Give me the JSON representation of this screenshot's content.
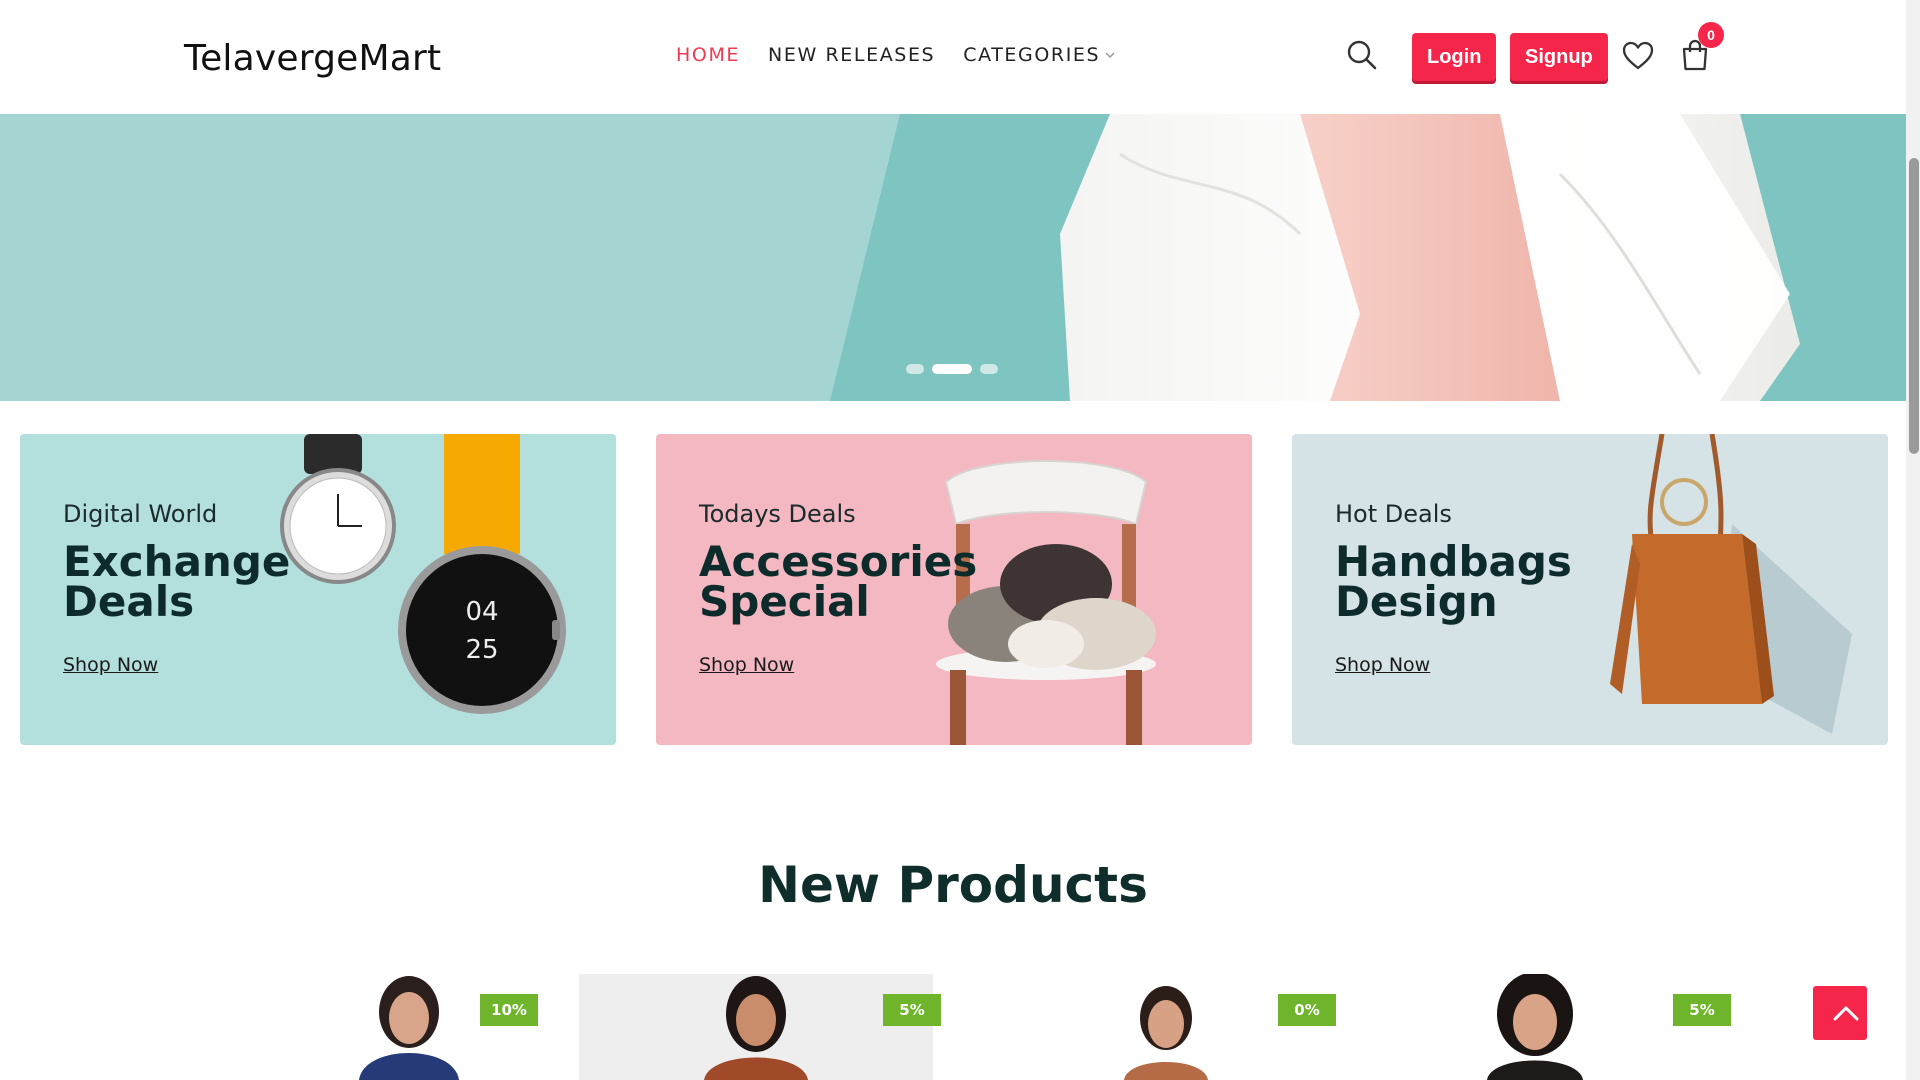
{
  "header": {
    "logo": "TelavergeMart",
    "nav": [
      {
        "label": "HOME",
        "active": true
      },
      {
        "label": "NEW RELEASES",
        "active": false
      },
      {
        "label": "CATEGORIES",
        "active": false
      }
    ],
    "login_label": "Login",
    "signup_label": "Signup",
    "cart_count": "0"
  },
  "hero": {
    "slides": 3,
    "active_slide": 2
  },
  "promos": [
    {
      "kicker": "Digital World",
      "title": "Exchange Deals",
      "cta": "Shop Now",
      "bg": "#b3dfdd"
    },
    {
      "kicker": "Todays Deals",
      "title": "Accessories Special",
      "cta": "Shop Now",
      "bg": "#f3b8c2"
    },
    {
      "kicker": "Hot Deals",
      "title": "Handbags Design",
      "cta": "Shop Now",
      "bg": "#d6e3e6"
    }
  ],
  "new_products": {
    "title": "New Products",
    "items": [
      {
        "discount": "10%"
      },
      {
        "discount": "5%"
      },
      {
        "discount": "0%"
      },
      {
        "discount": "5%"
      }
    ]
  },
  "colors": {
    "accent": "#f6264b",
    "badge_green": "#6fb52b",
    "heading": "#0f2d2a"
  },
  "icons": [
    "search-icon",
    "heart-icon",
    "cart-icon",
    "chevron-down-icon",
    "arrow-up-icon"
  ]
}
